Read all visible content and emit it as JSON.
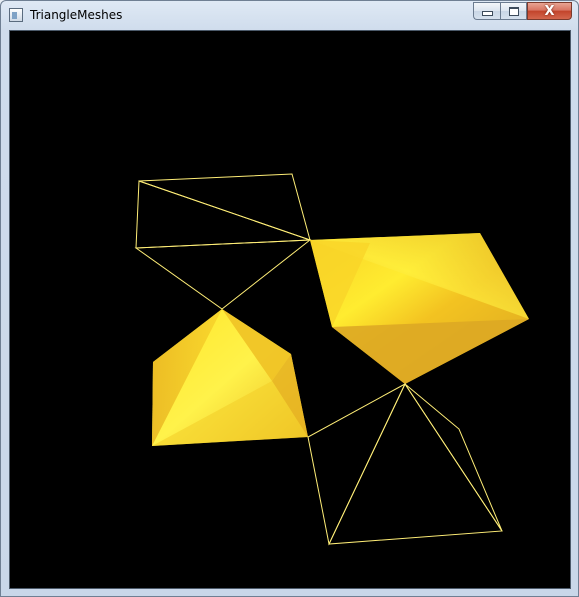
{
  "window": {
    "title": "TriangleMeshes",
    "icon": "app-window-icon"
  },
  "caption_buttons": {
    "minimize_icon": "minimize-icon",
    "maximize_icon": "maximize-icon",
    "close_glyph": "X"
  },
  "viewport": {
    "background": "#000000",
    "wire_color": "#ffee66",
    "fill_color": "#f5c61a"
  }
}
